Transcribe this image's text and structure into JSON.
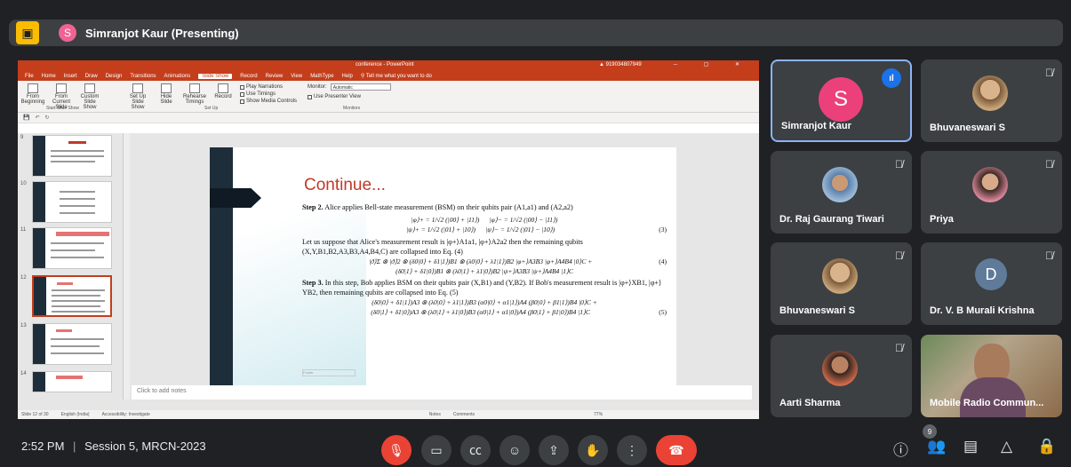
{
  "meet": {
    "presenter_label": "Simranjot Kaur (Presenting)",
    "presenter_initial": "S",
    "time": "2:52 PM",
    "separator": "|",
    "meeting_title": "Session 5, MRCN-2023",
    "participant_count": "9"
  },
  "ppt": {
    "doc_title": "conference - PowerPoint",
    "warning_text": "919034807949",
    "menus": [
      "File",
      "Home",
      "Insert",
      "Draw",
      "Design",
      "Transitions",
      "Animations",
      "Slide Show",
      "Record",
      "Review",
      "View",
      "MathType",
      "Help",
      "Tell me what you want to do"
    ],
    "active_menu": "Slide Show",
    "ribbon": {
      "from_beginning": "From Beginning",
      "from_current": "From Current Slide",
      "custom_show": "Custom Slide Show",
      "set_up": "Set Up Slide Show",
      "hide_slide": "Hide Slide",
      "rehearse": "Rehearse Timings",
      "record": "Record",
      "play_narrations": "Play Narrations",
      "use_timings": "Use Timings",
      "show_media": "Show Media Controls",
      "monitor_label": "Monitor:",
      "monitor_value": "Automatic",
      "presenter_view": "Use Presenter View",
      "group_start": "Start Slide Show",
      "group_setup": "Set Up",
      "group_monitors": "Monitors"
    },
    "thumb_numbers": [
      "9",
      "10",
      "11",
      "12",
      "13",
      "14"
    ],
    "notes_placeholder": "Click to add notes",
    "status": {
      "slide_of": "Slide 12 of 30",
      "language": "English (India)",
      "accessibility": "Accessibility: Investigate",
      "notes": "Notes",
      "comments": "Comments",
      "zoom": "77%"
    }
  },
  "slide": {
    "heading": "Continue...",
    "step2_label": "Step 2.",
    "step2_text": "Alice applies Bell-state measurement (BSM) on their qubits pair (A1,a1) and (A2,a2)",
    "eq_phi_plus": "|φ⟩+ = 1/√2 (|00⟩ + |11⟩)",
    "eq_phi_minus": "|φ⟩− = 1/√2 (|00⟩ − |11⟩)",
    "eq_psi_plus": "|ψ⟩+ = 1/√2 (|01⟩ + |10⟩)",
    "eq_psi_minus": "|ψ⟩− = 1/√2 (|01⟩ − |10⟩)",
    "eq3_num": "(3)",
    "suppose_text": "Let us suppose that Alice's measurement result is |φ+⟩A1a1, |φ+⟩A2a2 then the remaining qubits (X,Y,B1,B2,A3,B3,A4,B4,C) are collapsed into Eq. (4)",
    "eq4_line1": "|ϑ⟩Σ ⊗ |ϑ⟩2 ⊗ (δ0|0⟩ + δ1|1⟩)B1 ⊗ (λ0|0⟩ + λ1|1⟩)B2 |φ+⟩A3B3 |φ+⟩A4B4 |0⟩C +",
    "eq4_line2": "(δ0|1⟩ + δ1|0⟩)B1 ⊗ (λ0|1⟩ + λ1|0⟩)B2 |ψ+⟩A3B3 |ψ+⟩A4B4 |1⟩C",
    "eq4_num": "(4)",
    "step3_label": "Step 3.",
    "step3_text": "In this step, Bob applies BSM on their qubits pair (X,B1) and (Y,B2). If Bob's measurement result is |φ+⟩XB1, |φ+⟩YB2, then remaining qubits are collapsed into Eq. (5)",
    "eq5_line1": "(δ0|0⟩ + δ1|1⟩)A3 ⊗ (λ0|0⟩ + λ1|1⟩)B3 (α0|0⟩ + α1|1⟩)A4 (β0|0⟩ + β1|1⟩)B4 |0⟩C +",
    "eq5_line2": "(δ0|1⟩ + δ1|0⟩)A3 ⊗ (λ0|1⟩ + λ1|0⟩)B3 (α0|1⟩ + α1|0⟩)A4 (β0|1⟩ + β1|0⟩)B4 |1⟩C",
    "eq5_num": "(5)",
    "footer": "Footer"
  },
  "participants": [
    {
      "name": "Simranjot Kaur",
      "initial": "S",
      "speaking": true
    },
    {
      "name": "Bhuvaneswari S"
    },
    {
      "name": "Dr. Raj Gaurang Tiwari"
    },
    {
      "name": "Priya"
    },
    {
      "name": "Bhuvaneswari S"
    },
    {
      "name": "Dr. V. B Murali Krishna",
      "initial": "D"
    },
    {
      "name": "Aarti Sharma"
    },
    {
      "name": "Mobile Radio Commun..."
    }
  ],
  "colors": {
    "background": "#202124",
    "tile": "#3c4043",
    "ppt_accent": "#c43e1c",
    "leave_red": "#ea4335",
    "speaking_blue": "#1a73e8",
    "slide_heading": "#c0392b"
  },
  "icons": {
    "mic_off": "mic-off-icon",
    "camera": "camera-icon",
    "captions": "captions-icon",
    "emoji": "emoji-icon",
    "present": "present-icon",
    "raise_hand": "raise-hand-icon",
    "more": "more-options-icon",
    "leave": "leave-call-icon",
    "info": "info-icon",
    "people": "people-icon",
    "chat": "chat-icon",
    "activities": "activities-icon",
    "lock": "host-controls-icon"
  }
}
